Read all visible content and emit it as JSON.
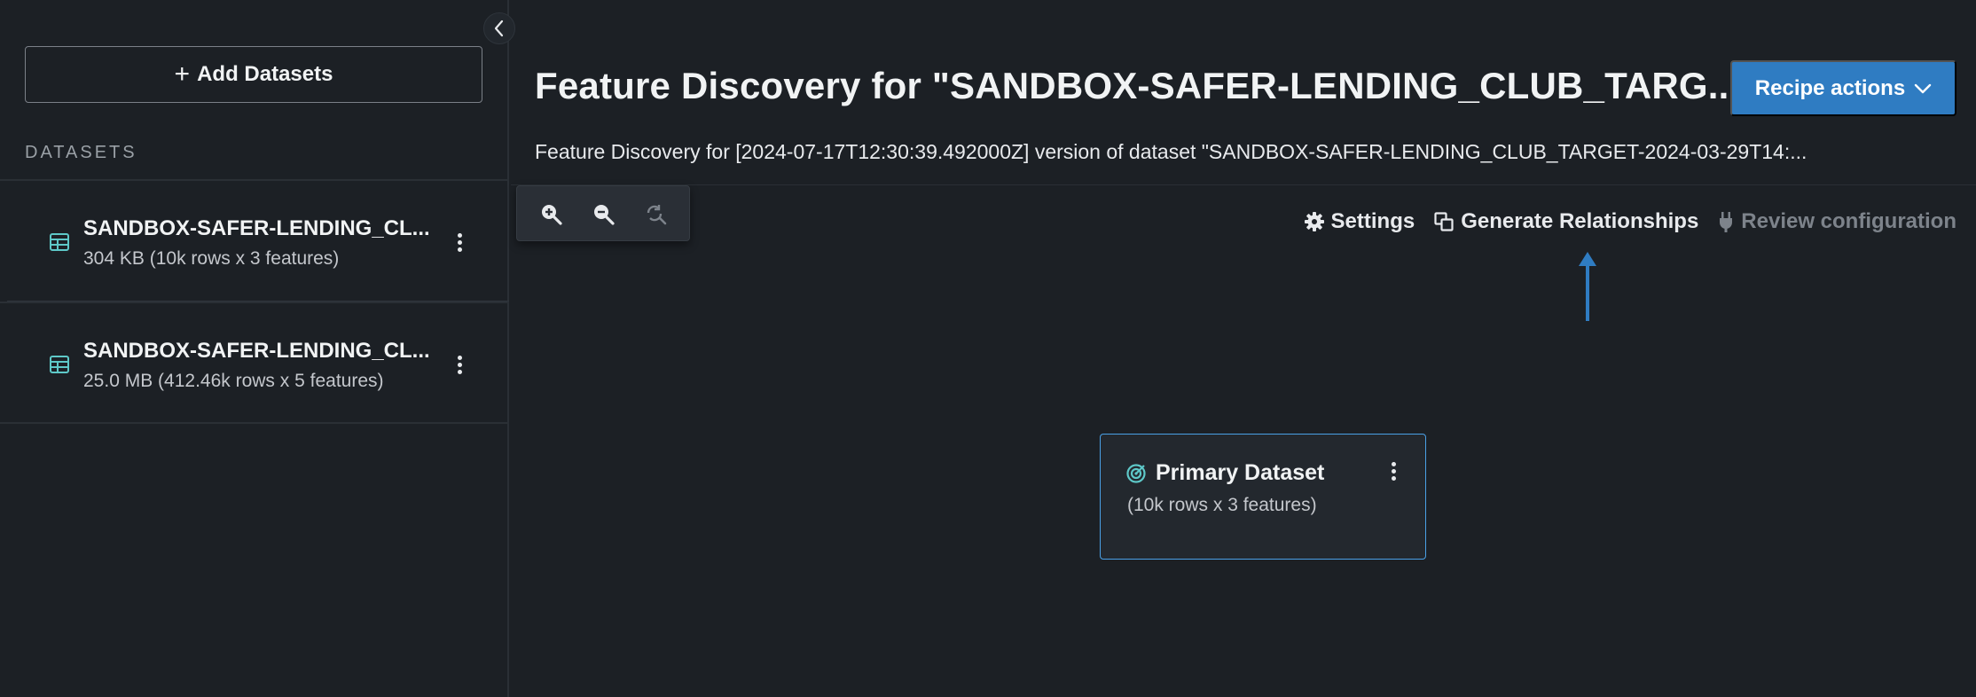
{
  "sidebar": {
    "add_datasets_label": "Add Datasets",
    "section_label": "DATASETS",
    "datasets": [
      {
        "name": "SANDBOX-SAFER-LENDING_CL...",
        "meta": "304 KB (10k rows x 3 features)"
      },
      {
        "name": "SANDBOX-SAFER-LENDING_CL...",
        "meta": "25.0 MB (412.46k rows x 5 features)"
      }
    ]
  },
  "main": {
    "title": "Feature Discovery for \"SANDBOX-SAFER-LENDING_CLUB_TARG...",
    "subtitle": "Feature Discovery for [2024-07-17T12:30:39.492000Z] version of dataset \"SANDBOX-SAFER-LENDING_CLUB_TARGET-2024-03-29T14:...",
    "recipe_actions_label": "Recipe actions",
    "actions": {
      "settings": "Settings",
      "generate_relationships": "Generate Relationships",
      "review_configuration": "Review configuration"
    },
    "zoom_toolbar": {
      "zoom_in_icon": "zoom-in-icon",
      "zoom_out_icon": "zoom-out-icon",
      "reset_icon": "reset-zoom-icon"
    },
    "node": {
      "title": "Primary Dataset",
      "meta": "(10k rows x 3 features)"
    }
  },
  "colors": {
    "background": "#1c2025",
    "accent": "#2f7cc2",
    "node_border": "#4aa0e6",
    "dataset_icon": "#5ec8c8",
    "disabled_text": "#7d838b"
  }
}
